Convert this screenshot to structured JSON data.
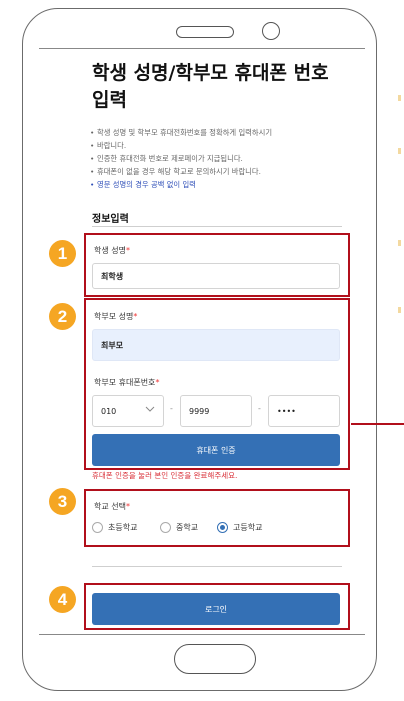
{
  "page": {
    "title_line1": "학생 성명/학부모 휴대폰 번호",
    "title_line2": "입력",
    "notes": [
      "학생 성명 및 학부모 휴대전화번호를 정확하게 입력하시기",
      "바랍니다.",
      "인증한 휴대전화 번호로 제로페이가 지급됩니다.",
      "휴대폰이 없을 경우 해당 학교로 문의하시기 바랍니다.",
      "영문 성명의 경우 공백 없이 입력"
    ],
    "section_title": "정보입력"
  },
  "student": {
    "label": "학생 성명",
    "required_mark": "*",
    "value": "최학생"
  },
  "parent": {
    "name_label": "학부모 성명",
    "name_value": "최부모",
    "phone_label": "학부모 휴대폰번호",
    "phone_prefix": "010",
    "phone_middle": "9999",
    "phone_last": "••••",
    "dash": "-",
    "verify_button": "휴대폰 인증",
    "error_text": "휴대폰 인증을 눌러 본인 인증을 완료해주세요."
  },
  "school": {
    "label": "학교 선택",
    "options": [
      "초등학교",
      "중학교",
      "고등학교"
    ],
    "selected": "고등학교"
  },
  "login_button": "로그인",
  "badges": [
    "1",
    "2",
    "3",
    "4"
  ],
  "colors": {
    "accent": "#3470b5",
    "highlight_box": "#b10f1b",
    "badge": "#f5a623",
    "error": "#d9323a"
  }
}
